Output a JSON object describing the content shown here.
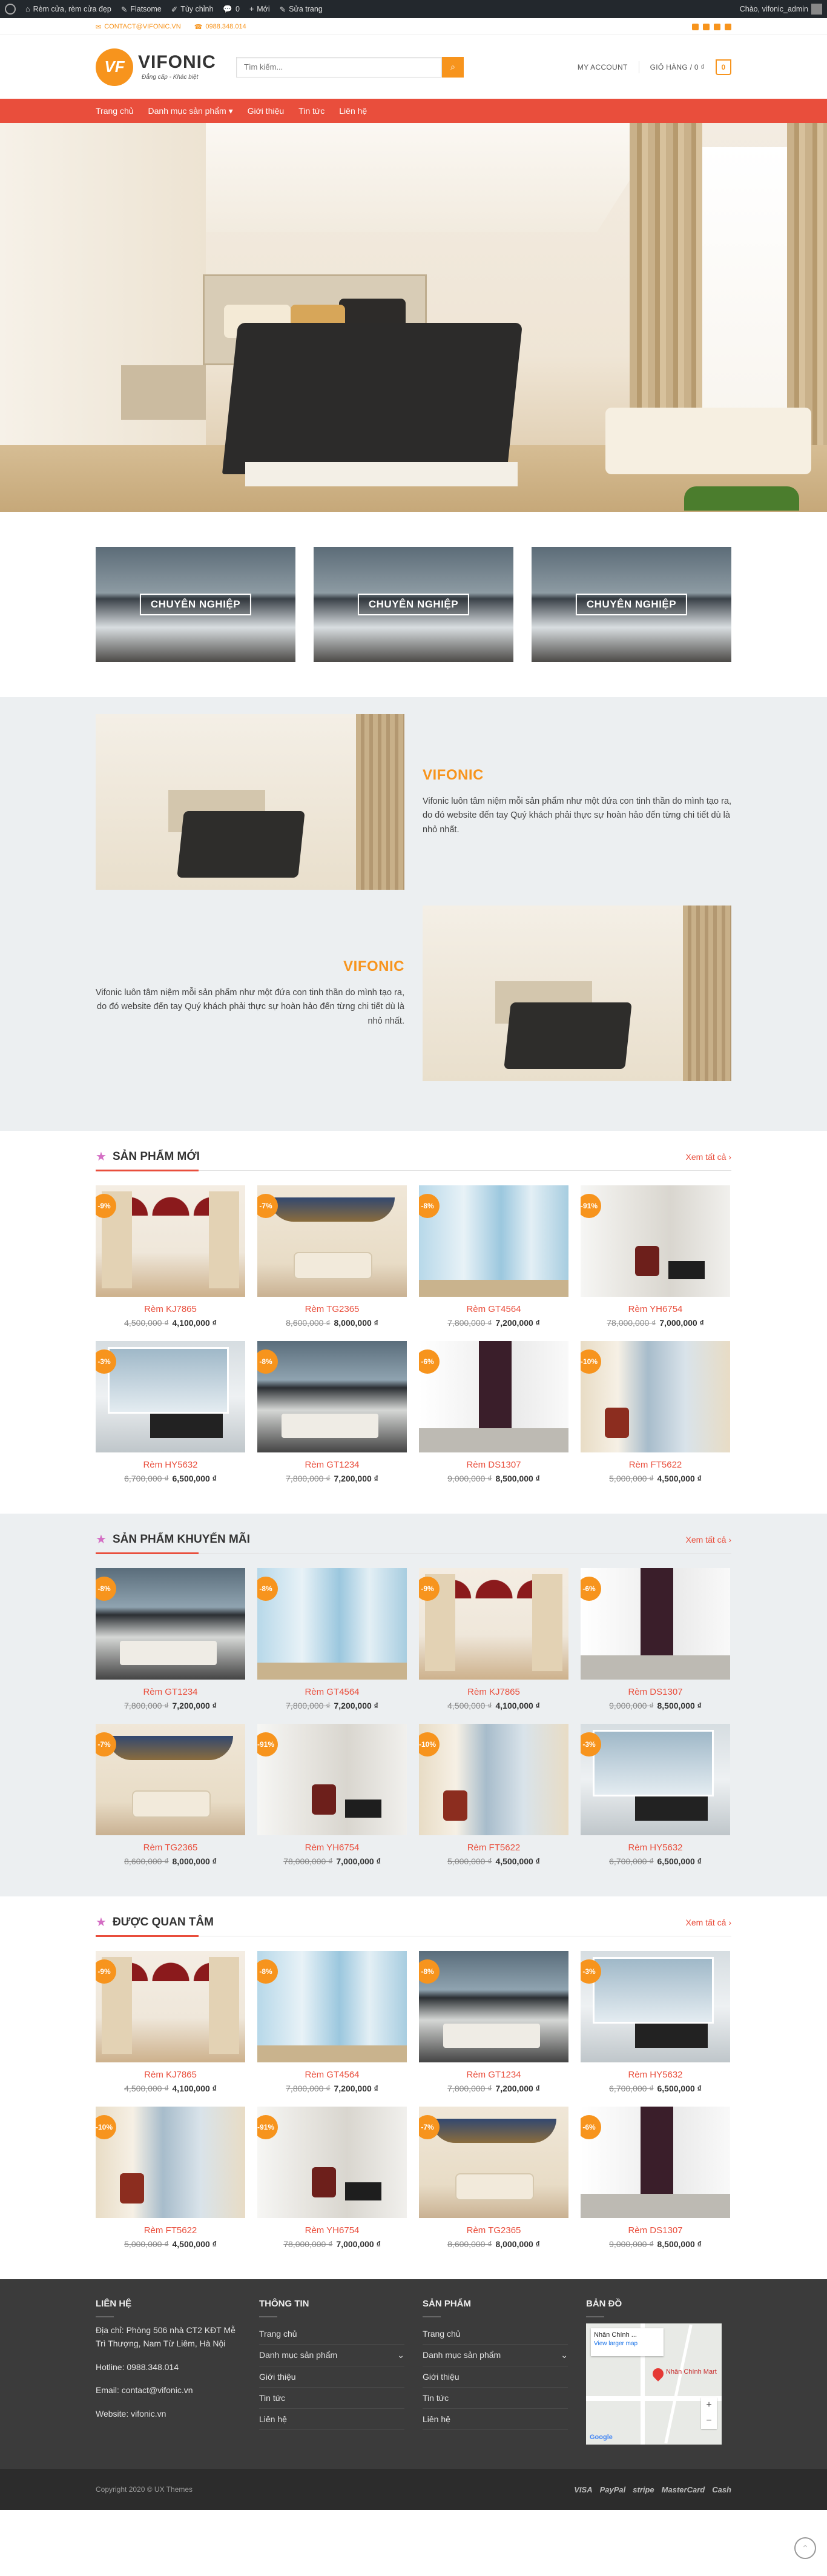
{
  "admin_bar": {
    "site_name": "Rèm cửa, rèm cửa đẹp",
    "theme": "Flatsome",
    "customize": "Tùy chỉnh",
    "comments": "0",
    "new": "Mới",
    "edit": "Sửa trang",
    "greeting": "Chào, vifonic_admin"
  },
  "topbar": {
    "email": "CONTACT@VIFONIC.VN",
    "phone": "0988.348.014"
  },
  "header": {
    "logo_mark": "VF",
    "logo_name": "VIFONIC",
    "slogan": "Đẳng cấp - Khác biệt",
    "search_placeholder": "Tìm kiếm...",
    "account": "MY ACCOUNT",
    "cart_label": "GIỎ HÀNG / 0 ₫",
    "cart_count": "0"
  },
  "nav": [
    "Trang chủ",
    "Danh mục sản phẩm",
    "Giới thiệu",
    "Tin tức",
    "Liên hệ"
  ],
  "banners": [
    "CHUYÊN NGHIỆP",
    "CHUYÊN NGHIỆP",
    "CHUYÊN NGHIỆP"
  ],
  "about": {
    "title": "VIFONIC",
    "text": "Vifonic luôn tâm niệm mỗi sản phẩm như một đứa con tinh thần do mình tạo ra, do đó website đến tay Quý khách phải thực sự hoàn hảo đến từng chi tiết dù là nhỏ nhất."
  },
  "sections": [
    {
      "title": "SẢN PHẨM MỚI",
      "see_all": "Xem tất cả",
      "products": [
        {
          "badge": "-9%",
          "name": "Rèm KJ7865",
          "old": "4,500,000 ₫",
          "new": "4,100,000 ₫",
          "img": "kj"
        },
        {
          "badge": "-7%",
          "name": "Rèm TG2365",
          "old": "8,600,000 ₫",
          "new": "8,000,000 ₫",
          "img": "tg"
        },
        {
          "badge": "-8%",
          "name": "Rèm GT4564",
          "old": "7,800,000 ₫",
          "new": "7,200,000 ₫",
          "img": "gt"
        },
        {
          "badge": "-91%",
          "name": "Rèm YH6754",
          "old": "78,000,000 ₫",
          "new": "7,000,000 ₫",
          "img": "yh"
        },
        {
          "badge": "-3%",
          "name": "Rèm HY5632",
          "old": "6,700,000 ₫",
          "new": "6,500,000 ₫",
          "img": "hy"
        },
        {
          "badge": "-8%",
          "name": "Rèm GT1234",
          "old": "7,800,000 ₫",
          "new": "7,200,000 ₫",
          "img": "gt12"
        },
        {
          "badge": "-6%",
          "name": "Rèm DS1307",
          "old": "9,000,000 ₫",
          "new": "8,500,000 ₫",
          "img": "ds"
        },
        {
          "badge": "-10%",
          "name": "Rèm FT5622",
          "old": "5,000,000 ₫",
          "new": "4,500,000 ₫",
          "img": "ft"
        }
      ]
    },
    {
      "title": "SẢN PHẨM KHUYẾN MÃI",
      "see_all": "Xem tất cả",
      "products": [
        {
          "badge": "-8%",
          "name": "Rèm GT1234",
          "old": "7,800,000 ₫",
          "new": "7,200,000 ₫",
          "img": "gt12"
        },
        {
          "badge": "-8%",
          "name": "Rèm GT4564",
          "old": "7,800,000 ₫",
          "new": "7,200,000 ₫",
          "img": "gt"
        },
        {
          "badge": "-9%",
          "name": "Rèm KJ7865",
          "old": "4,500,000 ₫",
          "new": "4,100,000 ₫",
          "img": "kj"
        },
        {
          "badge": "-6%",
          "name": "Rèm DS1307",
          "old": "9,000,000 ₫",
          "new": "8,500,000 ₫",
          "img": "ds"
        },
        {
          "badge": "-7%",
          "name": "Rèm TG2365",
          "old": "8,600,000 ₫",
          "new": "8,000,000 ₫",
          "img": "tg"
        },
        {
          "badge": "-91%",
          "name": "Rèm YH6754",
          "old": "78,000,000 ₫",
          "new": "7,000,000 ₫",
          "img": "yh"
        },
        {
          "badge": "-10%",
          "name": "Rèm FT5622",
          "old": "5,000,000 ₫",
          "new": "4,500,000 ₫",
          "img": "ft"
        },
        {
          "badge": "-3%",
          "name": "Rèm HY5632",
          "old": "6,700,000 ₫",
          "new": "6,500,000 ₫",
          "img": "hy"
        }
      ]
    },
    {
      "title": "ĐƯỢC QUAN TÂM",
      "see_all": "Xem tất cả",
      "products": [
        {
          "badge": "-9%",
          "name": "Rèm KJ7865",
          "old": "4,500,000 ₫",
          "new": "4,100,000 ₫",
          "img": "kj"
        },
        {
          "badge": "-8%",
          "name": "Rèm GT4564",
          "old": "7,800,000 ₫",
          "new": "7,200,000 ₫",
          "img": "gt"
        },
        {
          "badge": "-8%",
          "name": "Rèm GT1234",
          "old": "7,800,000 ₫",
          "new": "7,200,000 ₫",
          "img": "gt12"
        },
        {
          "badge": "-3%",
          "name": "Rèm HY5632",
          "old": "6,700,000 ₫",
          "new": "6,500,000 ₫",
          "img": "hy"
        },
        {
          "badge": "-10%",
          "name": "Rèm FT5622",
          "old": "5,000,000 ₫",
          "new": "4,500,000 ₫",
          "img": "ft"
        },
        {
          "badge": "-91%",
          "name": "Rèm YH6754",
          "old": "78,000,000 ₫",
          "new": "7,000,000 ₫",
          "img": "yh"
        },
        {
          "badge": "-7%",
          "name": "Rèm TG2365",
          "old": "8,600,000 ₫",
          "new": "8,000,000 ₫",
          "img": "tg"
        },
        {
          "badge": "-6%",
          "name": "Rèm DS1307",
          "old": "9,000,000 ₫",
          "new": "8,500,000 ₫",
          "img": "ds"
        }
      ]
    }
  ],
  "footer": {
    "contact_title": "LIÊN HỆ",
    "address": "Địa chỉ: Phòng 506 nhà CT2 KĐT Mễ Trì Thượng, Nam Từ Liêm, Hà Nội",
    "hotline": "Hotline: 0988.348.014",
    "email": "Email: contact@vifonic.vn",
    "website": "Website: vifonic.vn",
    "info_title": "THÔNG TIN",
    "info_links": [
      "Trang chủ",
      "Danh mục sản phẩm",
      "Giới thiệu",
      "Tin tức",
      "Liên hệ"
    ],
    "product_title": "SẢN PHẨM",
    "product_links": [
      "Trang chủ",
      "Danh mục sản phẩm",
      "Giới thiệu",
      "Tin tức",
      "Liên hệ"
    ],
    "map_title": "BẢN ĐỒ",
    "map_place": "Nhân Chính ...",
    "map_link": "View larger map",
    "map_pin_label": "Nhân Chính Mart",
    "map_brand": "Google",
    "copyright": "Copyright 2020 © UX Themes",
    "payments": [
      "VISA",
      "PayPal",
      "stripe",
      "MasterCard",
      "Cash"
    ]
  },
  "colors": {
    "accent": "#f7941d",
    "nav": "#e94e3c",
    "footer": "#3b3b3b"
  }
}
